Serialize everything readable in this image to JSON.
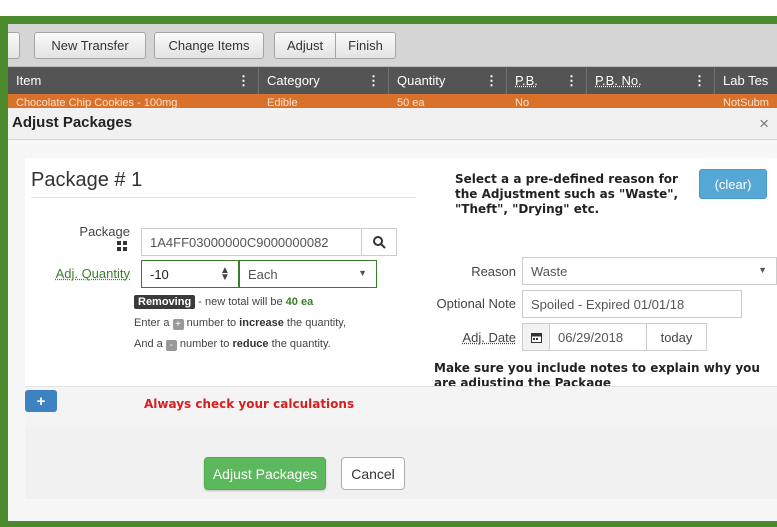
{
  "toolbar": {
    "new_transfer": "New Transfer",
    "change_items": "Change Items",
    "adjust": "Adjust",
    "finish": "Finish"
  },
  "grid": {
    "columns": [
      {
        "label": "Item"
      },
      {
        "label": "Category"
      },
      {
        "label": "Quantity"
      },
      {
        "label": "P.B."
      },
      {
        "label": "P.B. No."
      },
      {
        "label": "Lab Tes"
      }
    ],
    "row": {
      "item": "Chocolate Chip Cookies - 100mg",
      "category": "Edible",
      "quantity": "50 ea",
      "pb": "No",
      "pb_no": "",
      "lab": "NotSubm"
    }
  },
  "modal": {
    "title": "Adjust Packages",
    "close": "×",
    "package_title": "Package # 1",
    "package_label": "Package",
    "package_value": "1A4FF03000000C9000000082",
    "adj_qty_label": "Adj. Quantity",
    "adj_qty_value": "-10",
    "unit_value": "Each",
    "removing_badge": "Removing",
    "removing_text": " - new total will be ",
    "removing_total": "40 ea",
    "help_line2_a": "Enter a ",
    "help_line2_b": " number to ",
    "help_line2_c": "increase",
    "help_line2_d": " the quantity,",
    "help_line3_a": "And a ",
    "help_line3_b": " number to ",
    "help_line3_c": "reduce",
    "help_line3_d": " the quantity.",
    "reason_label": "Reason",
    "reason_value": "Waste",
    "note_label": "Optional Note",
    "note_value": "Spoiled - Expired 01/01/18",
    "date_label": "Adj. Date",
    "date_value": "06/29/2018",
    "today_label": "today",
    "clear_label": "(clear)",
    "adjust_button": "Adjust Packages",
    "cancel_button": "Cancel"
  },
  "annotations": {
    "reason_hint": "Select a a pre-defined reason for the Adjustment such as \"Waste\", \"Theft\", \"Drying\" etc.",
    "notes_hint": "Make sure you include notes to explain why you are adjusting the Package",
    "calc_hint": "Always check your calculations"
  },
  "colors": {
    "frame": "#4b8a2d",
    "selected_row": "#d9712b",
    "header": "#545454",
    "primary_green": "#5cb85c",
    "info_blue": "#55a7d6",
    "annotation_red": "#d81e1e"
  }
}
